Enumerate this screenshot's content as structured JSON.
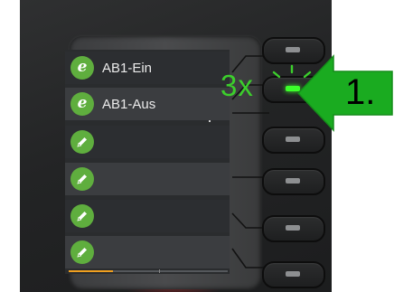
{
  "lines": [
    {
      "label": "AB1-Ein",
      "icon": "e-phone-icon"
    },
    {
      "label": "AB1-Aus",
      "icon": "e-phone-icon"
    },
    {
      "label": "",
      "icon": "pencil-edit-icon"
    },
    {
      "label": "",
      "icon": "pencil-edit-icon"
    },
    {
      "label": "",
      "icon": "pencil-edit-icon"
    },
    {
      "label": "",
      "icon": "pencil-edit-icon"
    }
  ],
  "annotation": {
    "press_count": "3x",
    "step_label": "1.",
    "highlight_color": "#3ccf2c"
  },
  "colors": {
    "icon_green": "#5fae3e",
    "led_lit": "#3cff2b",
    "page_indicator": "#f0a020"
  },
  "page_indicator": {
    "fraction": 0.28
  }
}
